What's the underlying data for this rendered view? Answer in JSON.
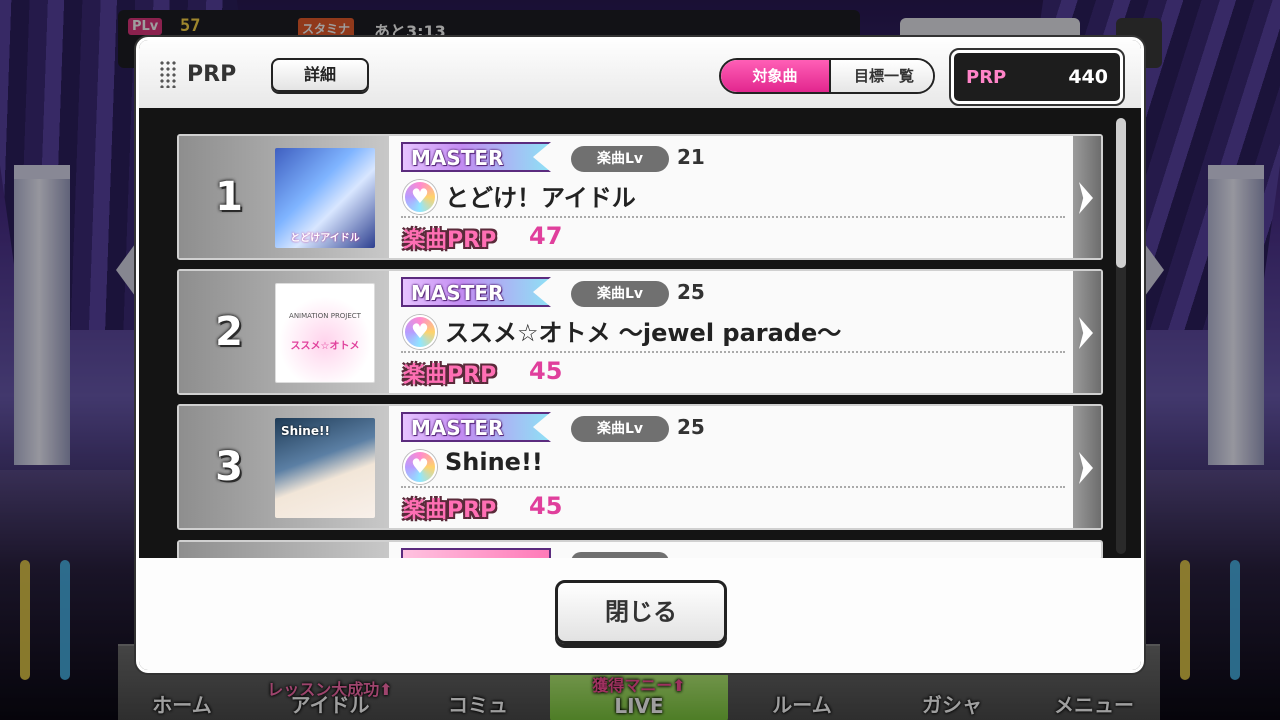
{
  "hud": {
    "plv_label": "PLv",
    "plv_value": "57",
    "stamina_label": "スタミナ",
    "stamina_time": "あと3:13"
  },
  "bottom_nav": [
    {
      "label": "ホーム",
      "sub": ""
    },
    {
      "label": "アイドル",
      "sub": "レッスン大成功⬆"
    },
    {
      "label": "コミュ",
      "sub": ""
    },
    {
      "label": "LIVE",
      "sub": "獲得マニー⬆"
    },
    {
      "label": "ルーム",
      "sub": ""
    },
    {
      "label": "ガシャ",
      "sub": ""
    },
    {
      "label": "メニュー",
      "sub": ""
    }
  ],
  "dialog": {
    "title": "PRP",
    "detail_button": "詳細",
    "tabs": [
      {
        "label": "対象曲",
        "active": true
      },
      {
        "label": "目標一覧",
        "active": false
      }
    ],
    "prp_total_label": "PRP",
    "prp_total_value": "440",
    "close_button": "閉じる"
  },
  "songs": [
    {
      "rank": "1",
      "difficulty": "MASTER",
      "level_label": "楽曲Lv",
      "level": "21",
      "title": "とどけ！アイドル",
      "jacket_text": "とどけアイドル",
      "prp_label": "楽曲PRP",
      "prp": "47"
    },
    {
      "rank": "2",
      "difficulty": "MASTER",
      "level_label": "楽曲Lv",
      "level": "25",
      "title": "ススメ☆オトメ ～jewel parade～",
      "jacket_text": "ススメ☆オトメ",
      "jacket_top": "ANIMATION PROJECT",
      "prp_label": "楽曲PRP",
      "prp": "45"
    },
    {
      "rank": "3",
      "difficulty": "MASTER",
      "level_label": "楽曲Lv",
      "level": "25",
      "title": "Shine!!",
      "jacket_text": "Shine!!",
      "prp_label": "楽曲PRP",
      "prp": "45"
    }
  ],
  "colors": {
    "accent_pink": "#e2268e",
    "prp_value": "#e03f9c",
    "dialog_bg": "#111111"
  }
}
